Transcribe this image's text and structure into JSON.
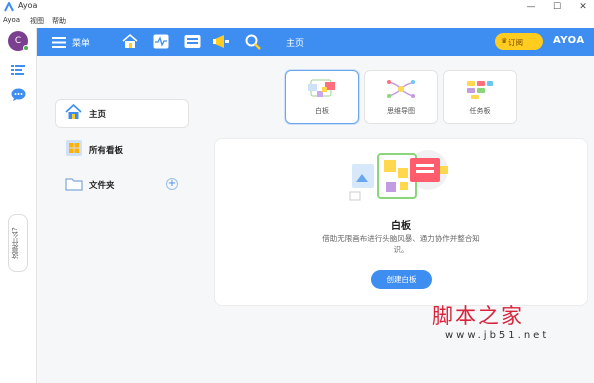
{
  "window": {
    "title": "Ayoa",
    "controls": [
      "—",
      "☐",
      "✕"
    ]
  },
  "menubar": [
    "Ayoa",
    "视图",
    "帮助"
  ],
  "user": {
    "initial": "C"
  },
  "help_tab": "这是什么?",
  "topbar": {
    "menu_label": "菜单",
    "page_heading": "主页",
    "subscribe_label": "订阅",
    "brand": "AYOA"
  },
  "sidebar": {
    "items": [
      {
        "label": "主页",
        "icon": "home-icon"
      },
      {
        "label": "所有看板",
        "icon": "boards-icon"
      },
      {
        "label": "文件夹",
        "icon": "folder-icon"
      }
    ]
  },
  "templates": [
    {
      "label": "白板"
    },
    {
      "label": "思维导图"
    },
    {
      "label": "任务板"
    }
  ],
  "detail": {
    "title": "白板",
    "description": "借助无限画布进行头脑风暴、通力协作并整合知识。",
    "create_label": "创建白板"
  },
  "watermark": {
    "text": "脚本之家",
    "url": "www.jb51.net"
  },
  "colors": {
    "accent": "#3d8ef0",
    "subscribe": "#ffcc1f",
    "avatar": "#7b3f8f",
    "watermark": "#d9233a"
  }
}
